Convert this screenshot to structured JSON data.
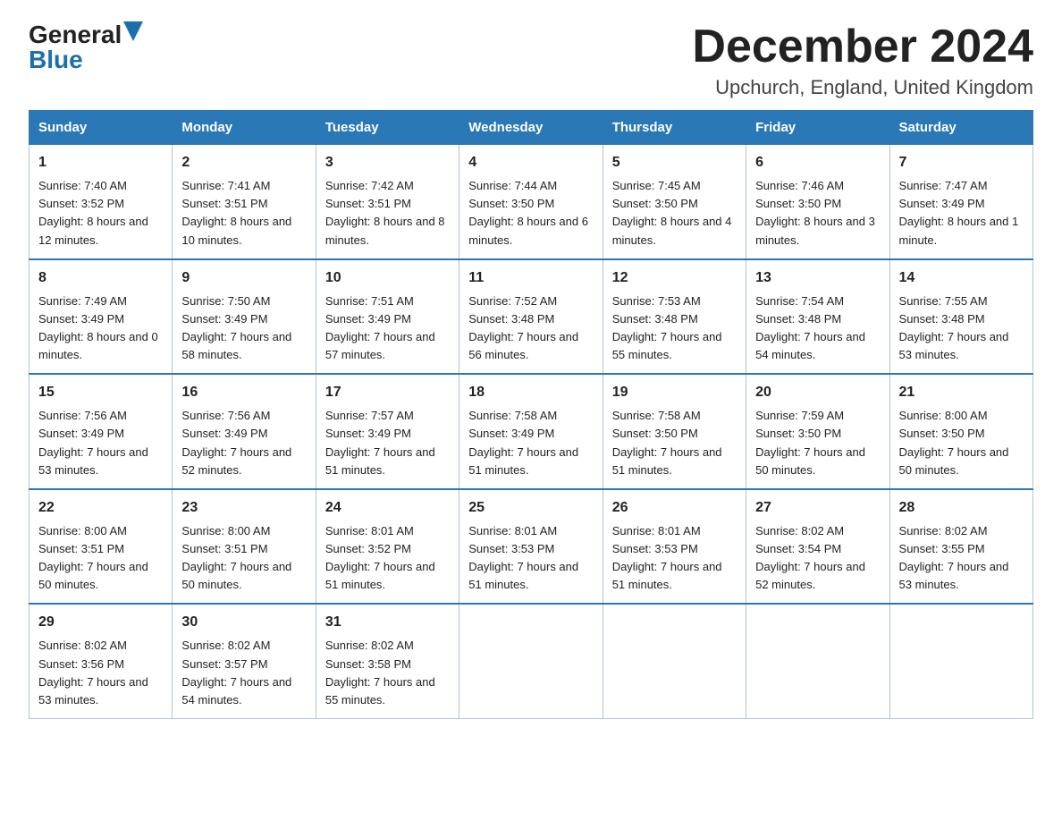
{
  "logo": {
    "general": "General",
    "blue": "Blue"
  },
  "title": "December 2024",
  "location": "Upchurch, England, United Kingdom",
  "days_of_week": [
    "Sunday",
    "Monday",
    "Tuesday",
    "Wednesday",
    "Thursday",
    "Friday",
    "Saturday"
  ],
  "weeks": [
    [
      {
        "day": "1",
        "sunrise": "7:40 AM",
        "sunset": "3:52 PM",
        "daylight": "8 hours and 12 minutes."
      },
      {
        "day": "2",
        "sunrise": "7:41 AM",
        "sunset": "3:51 PM",
        "daylight": "8 hours and 10 minutes."
      },
      {
        "day": "3",
        "sunrise": "7:42 AM",
        "sunset": "3:51 PM",
        "daylight": "8 hours and 8 minutes."
      },
      {
        "day": "4",
        "sunrise": "7:44 AM",
        "sunset": "3:50 PM",
        "daylight": "8 hours and 6 minutes."
      },
      {
        "day": "5",
        "sunrise": "7:45 AM",
        "sunset": "3:50 PM",
        "daylight": "8 hours and 4 minutes."
      },
      {
        "day": "6",
        "sunrise": "7:46 AM",
        "sunset": "3:50 PM",
        "daylight": "8 hours and 3 minutes."
      },
      {
        "day": "7",
        "sunrise": "7:47 AM",
        "sunset": "3:49 PM",
        "daylight": "8 hours and 1 minute."
      }
    ],
    [
      {
        "day": "8",
        "sunrise": "7:49 AM",
        "sunset": "3:49 PM",
        "daylight": "8 hours and 0 minutes."
      },
      {
        "day": "9",
        "sunrise": "7:50 AM",
        "sunset": "3:49 PM",
        "daylight": "7 hours and 58 minutes."
      },
      {
        "day": "10",
        "sunrise": "7:51 AM",
        "sunset": "3:49 PM",
        "daylight": "7 hours and 57 minutes."
      },
      {
        "day": "11",
        "sunrise": "7:52 AM",
        "sunset": "3:48 PM",
        "daylight": "7 hours and 56 minutes."
      },
      {
        "day": "12",
        "sunrise": "7:53 AM",
        "sunset": "3:48 PM",
        "daylight": "7 hours and 55 minutes."
      },
      {
        "day": "13",
        "sunrise": "7:54 AM",
        "sunset": "3:48 PM",
        "daylight": "7 hours and 54 minutes."
      },
      {
        "day": "14",
        "sunrise": "7:55 AM",
        "sunset": "3:48 PM",
        "daylight": "7 hours and 53 minutes."
      }
    ],
    [
      {
        "day": "15",
        "sunrise": "7:56 AM",
        "sunset": "3:49 PM",
        "daylight": "7 hours and 53 minutes."
      },
      {
        "day": "16",
        "sunrise": "7:56 AM",
        "sunset": "3:49 PM",
        "daylight": "7 hours and 52 minutes."
      },
      {
        "day": "17",
        "sunrise": "7:57 AM",
        "sunset": "3:49 PM",
        "daylight": "7 hours and 51 minutes."
      },
      {
        "day": "18",
        "sunrise": "7:58 AM",
        "sunset": "3:49 PM",
        "daylight": "7 hours and 51 minutes."
      },
      {
        "day": "19",
        "sunrise": "7:58 AM",
        "sunset": "3:50 PM",
        "daylight": "7 hours and 51 minutes."
      },
      {
        "day": "20",
        "sunrise": "7:59 AM",
        "sunset": "3:50 PM",
        "daylight": "7 hours and 50 minutes."
      },
      {
        "day": "21",
        "sunrise": "8:00 AM",
        "sunset": "3:50 PM",
        "daylight": "7 hours and 50 minutes."
      }
    ],
    [
      {
        "day": "22",
        "sunrise": "8:00 AM",
        "sunset": "3:51 PM",
        "daylight": "7 hours and 50 minutes."
      },
      {
        "day": "23",
        "sunrise": "8:00 AM",
        "sunset": "3:51 PM",
        "daylight": "7 hours and 50 minutes."
      },
      {
        "day": "24",
        "sunrise": "8:01 AM",
        "sunset": "3:52 PM",
        "daylight": "7 hours and 51 minutes."
      },
      {
        "day": "25",
        "sunrise": "8:01 AM",
        "sunset": "3:53 PM",
        "daylight": "7 hours and 51 minutes."
      },
      {
        "day": "26",
        "sunrise": "8:01 AM",
        "sunset": "3:53 PM",
        "daylight": "7 hours and 51 minutes."
      },
      {
        "day": "27",
        "sunrise": "8:02 AM",
        "sunset": "3:54 PM",
        "daylight": "7 hours and 52 minutes."
      },
      {
        "day": "28",
        "sunrise": "8:02 AM",
        "sunset": "3:55 PM",
        "daylight": "7 hours and 53 minutes."
      }
    ],
    [
      {
        "day": "29",
        "sunrise": "8:02 AM",
        "sunset": "3:56 PM",
        "daylight": "7 hours and 53 minutes."
      },
      {
        "day": "30",
        "sunrise": "8:02 AM",
        "sunset": "3:57 PM",
        "daylight": "7 hours and 54 minutes."
      },
      {
        "day": "31",
        "sunrise": "8:02 AM",
        "sunset": "3:58 PM",
        "daylight": "7 hours and 55 minutes."
      },
      null,
      null,
      null,
      null
    ]
  ],
  "labels": {
    "sunrise": "Sunrise:",
    "sunset": "Sunset:",
    "daylight": "Daylight:"
  }
}
